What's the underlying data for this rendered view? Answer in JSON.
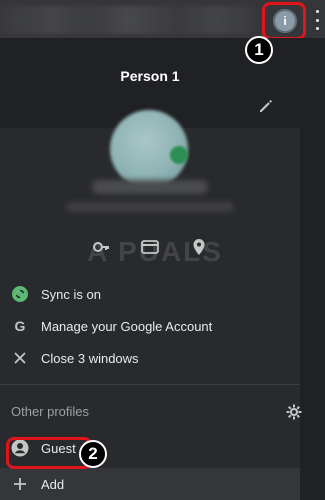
{
  "toolbar": {
    "profile_initial": "i"
  },
  "profile": {
    "name": "Person 1"
  },
  "watermark": "A PUALS",
  "menu": {
    "sync_label": "Sync is on",
    "manage_label": "Manage your Google Account",
    "close_windows_label": "Close 3 windows"
  },
  "other_profiles": {
    "heading": "Other profiles",
    "guest_label": "Guest",
    "add_label": "Add"
  },
  "annotations": {
    "step1": "1",
    "step2": "2"
  },
  "colors": {
    "highlight": "#e0151c",
    "sync_green": "#5bb974"
  }
}
